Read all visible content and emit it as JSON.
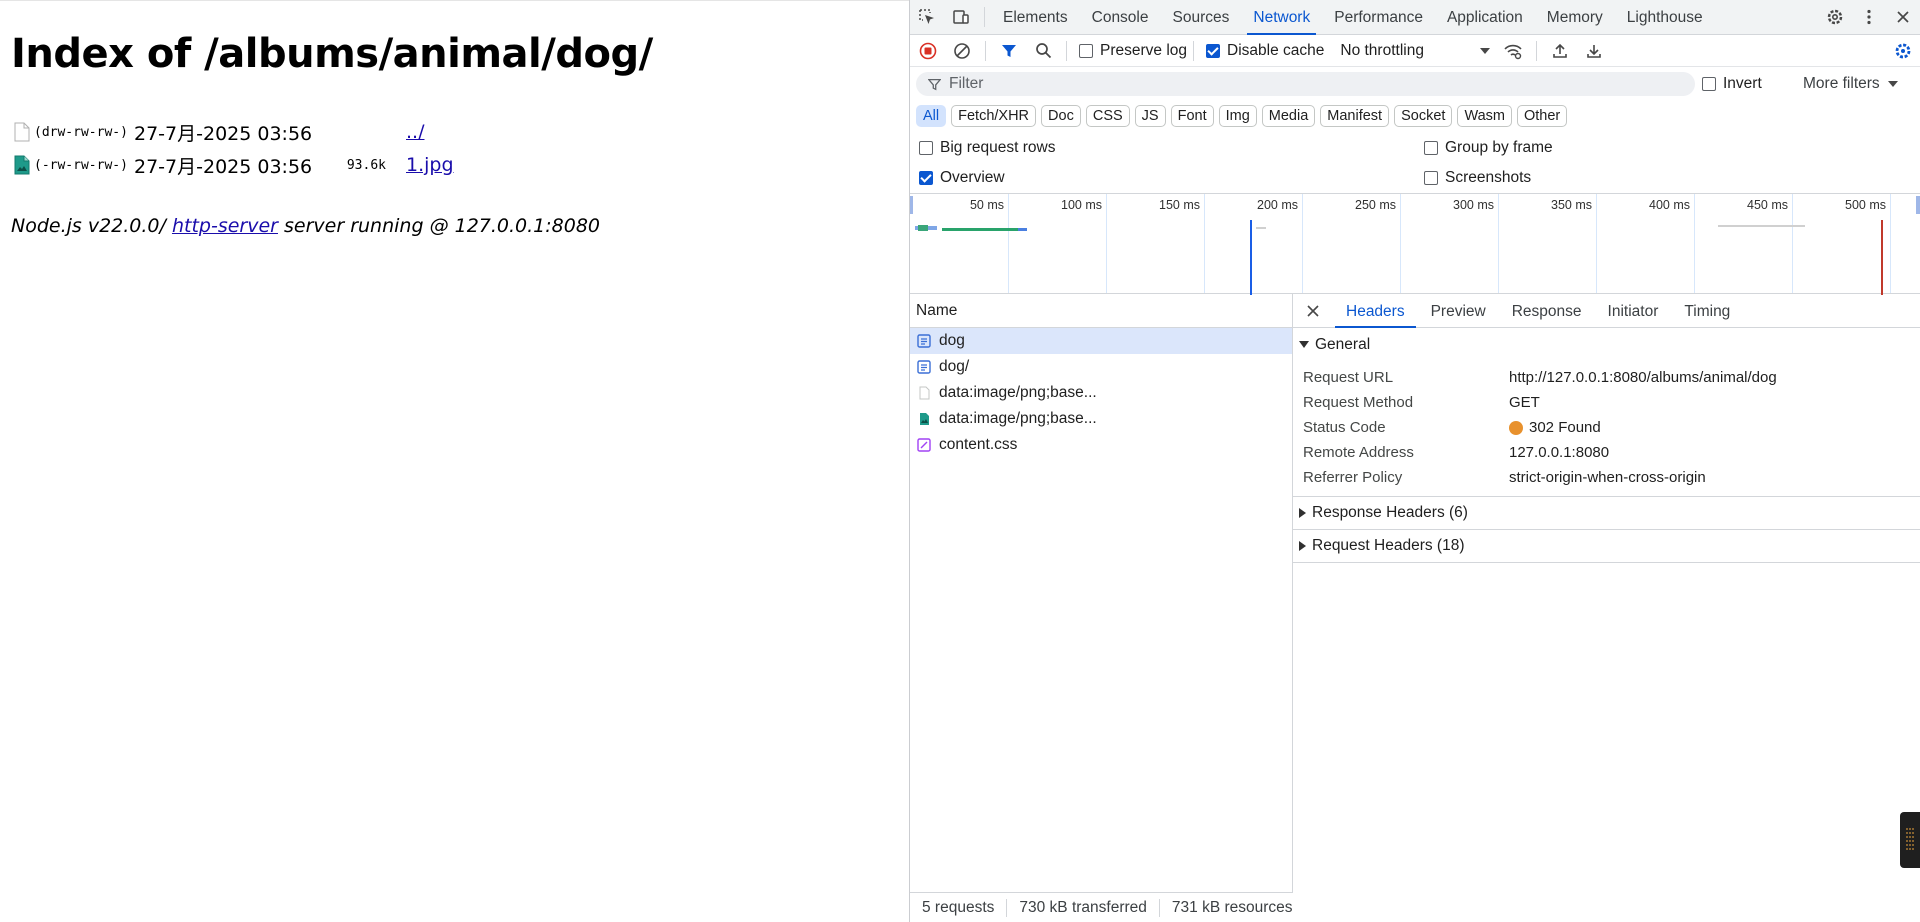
{
  "page": {
    "heading": "Index of /albums/animal/dog/",
    "entries": [
      {
        "perm": "(drw-rw-rw-)",
        "date": "27-7月-2025 03:56",
        "size": "",
        "name": "../",
        "icon": "blank-file-icon"
      },
      {
        "perm": "(-rw-rw-rw-)",
        "date": "27-7月-2025 03:56",
        "size": "93.6k",
        "name": "1.jpg",
        "icon": "image-file-icon"
      }
    ],
    "footer": {
      "prefix": "Node.js v22.0.0/ ",
      "link": "http-server",
      "suffix": " server running @ 127.0.0.1:8080"
    }
  },
  "devtools": {
    "tabs": [
      "Elements",
      "Console",
      "Sources",
      "Network",
      "Performance",
      "Application",
      "Memory",
      "Lighthouse"
    ],
    "active_tab": "Network",
    "toolbar": {
      "preserve_log": "Preserve log",
      "disable_cache": "Disable cache",
      "throttling": "No throttling"
    },
    "filter": {
      "placeholder": "Filter",
      "invert": "Invert",
      "more_filters": "More filters"
    },
    "type_filters": [
      "All",
      "Fetch/XHR",
      "Doc",
      "CSS",
      "JS",
      "Font",
      "Img",
      "Media",
      "Manifest",
      "Socket",
      "Wasm",
      "Other"
    ],
    "active_type": "All",
    "options": {
      "big_request_rows": "Big request rows",
      "group_by_frame": "Group by frame",
      "overview": "Overview",
      "screenshots": "Screenshots"
    },
    "timeline_labels": [
      "50 ms",
      "100 ms",
      "150 ms",
      "200 ms",
      "250 ms",
      "300 ms",
      "350 ms",
      "400 ms",
      "450 ms",
      "500 ms"
    ],
    "requests": {
      "header": "Name",
      "rows": [
        {
          "name": "dog",
          "icon": "document-icon",
          "selected": true
        },
        {
          "name": "dog/",
          "icon": "document-icon",
          "selected": false
        },
        {
          "name": "data:image/png;base...",
          "icon": "blank-image-icon",
          "selected": false
        },
        {
          "name": "data:image/png;base...",
          "icon": "image-icon",
          "selected": false
        },
        {
          "name": "content.css",
          "icon": "stylesheet-icon",
          "selected": false
        }
      ]
    },
    "detail": {
      "tabs": [
        "Headers",
        "Preview",
        "Response",
        "Initiator",
        "Timing"
      ],
      "active_tab": "Headers",
      "general_title": "General",
      "general": [
        {
          "key": "Request URL",
          "value": "http://127.0.0.1:8080/albums/animal/dog"
        },
        {
          "key": "Request Method",
          "value": "GET"
        },
        {
          "key": "Status Code",
          "value": "302 Found"
        },
        {
          "key": "Remote Address",
          "value": "127.0.0.1:8080"
        },
        {
          "key": "Referrer Policy",
          "value": "strict-origin-when-cross-origin"
        }
      ],
      "status_color": "#e8912d",
      "response_headers": "Response Headers (6)",
      "request_headers": "Request Headers (18)"
    },
    "status": {
      "requests": "5 requests",
      "transferred": "730 kB transferred",
      "resources": "731 kB resources"
    },
    "colors": {
      "accent": "#0b57d0",
      "selected_row": "#dbe6fb"
    }
  }
}
